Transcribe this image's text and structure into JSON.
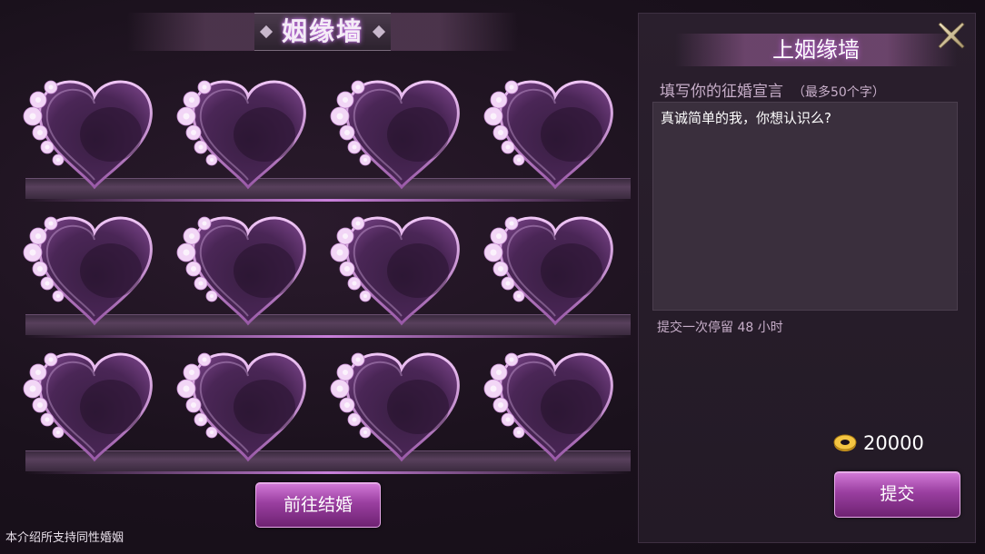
{
  "wall": {
    "title": "姻缘墙",
    "slots": [
      {
        "id": 1
      },
      {
        "id": 2
      },
      {
        "id": 3
      },
      {
        "id": 4
      },
      {
        "id": 5
      },
      {
        "id": 6
      },
      {
        "id": 7
      },
      {
        "id": 8
      },
      {
        "id": 9
      },
      {
        "id": 10
      },
      {
        "id": 11
      },
      {
        "id": 12
      }
    ],
    "goto_marry_label": "前往结婚",
    "footer_note": "本介绍所支持同性婚姻"
  },
  "post_panel": {
    "title": "上姻缘墙",
    "close_icon": "close-x-icon",
    "pledge_label": "填写你的征婚宣言",
    "pledge_limit": "（最多50个字）",
    "pledge_value": "真诚简单的我，你想认识么?",
    "stay_note": "提交一次停留 48 小时",
    "currency_icon": "gold-coin-icon",
    "cost": "20000",
    "submit_label": "提交"
  },
  "colors": {
    "accent": "#b85cc0",
    "button_top": "#d37ad8",
    "button_bottom": "#6e2272",
    "panel_bg": "#2a1f2d",
    "input_bg": "#3a2f3d"
  }
}
